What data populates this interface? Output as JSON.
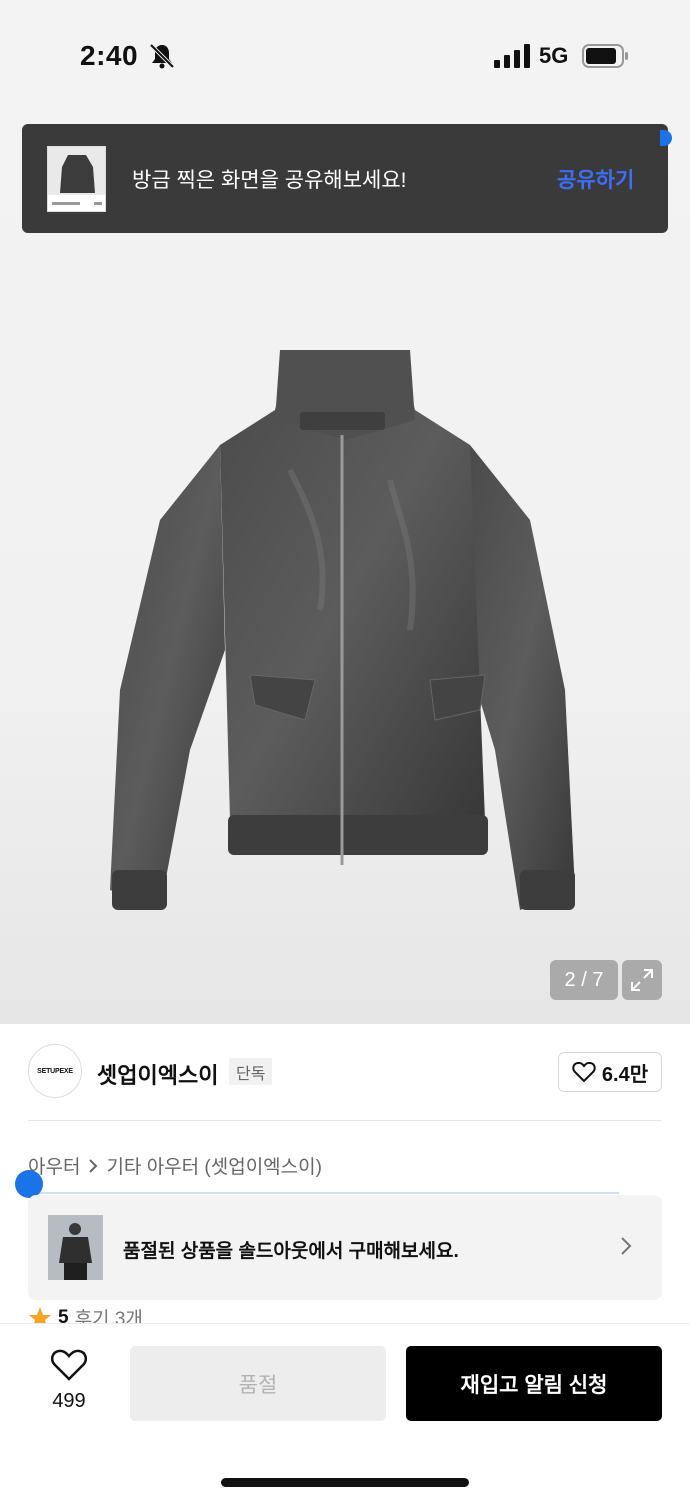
{
  "status_bar": {
    "time": "2:40",
    "network": "5G",
    "icons": [
      "bell-slash-icon",
      "signal-icon",
      "battery-icon"
    ]
  },
  "toast": {
    "message": "방금 찍은 화면을 공유해보세요!",
    "action_label": "공유하기",
    "accent_color": "#3d6ef5"
  },
  "gallery": {
    "counter": "2 / 7",
    "expand_icon": "expand-icon"
  },
  "brand": {
    "logo_text": "SETUPEXE",
    "name": "셋업이엑스이",
    "badge": "단독",
    "like_count": "6.4만"
  },
  "breadcrumb": {
    "items": [
      "아우터",
      "기타 아우터 (셋업이엑스이)"
    ]
  },
  "soldout_banner": {
    "text": "품절된 상품을 솔드아웃에서 구매해보세요."
  },
  "rating": {
    "score": "5",
    "reviews": "후기 3개"
  },
  "bottom_bar": {
    "wish_count": "499",
    "soldout_label": "품절",
    "restock_label": "재입고 알림 신청"
  }
}
